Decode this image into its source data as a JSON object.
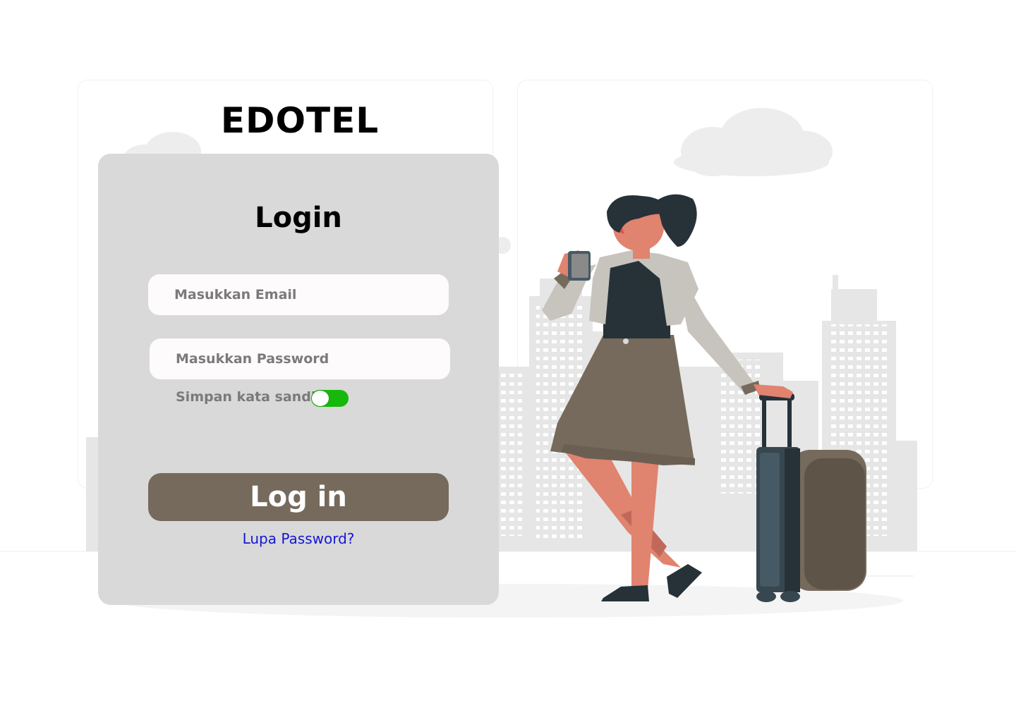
{
  "brand": {
    "title": "EDOTEL"
  },
  "login": {
    "title": "Login",
    "email_placeholder": "Masukkan Email",
    "password_placeholder": "Masukkan Password",
    "remember_label": "Simpan kata sandi",
    "remember_enabled": true,
    "submit_label": "Log in",
    "forgot_label": "Lupa Password?"
  },
  "colors": {
    "card_bg": "#d9d9d9",
    "button": "#766a5c",
    "toggle_on": "#16b90b",
    "link": "#1515d6"
  },
  "illustration": {
    "name": "traveler-with-suitcase-illustration"
  }
}
